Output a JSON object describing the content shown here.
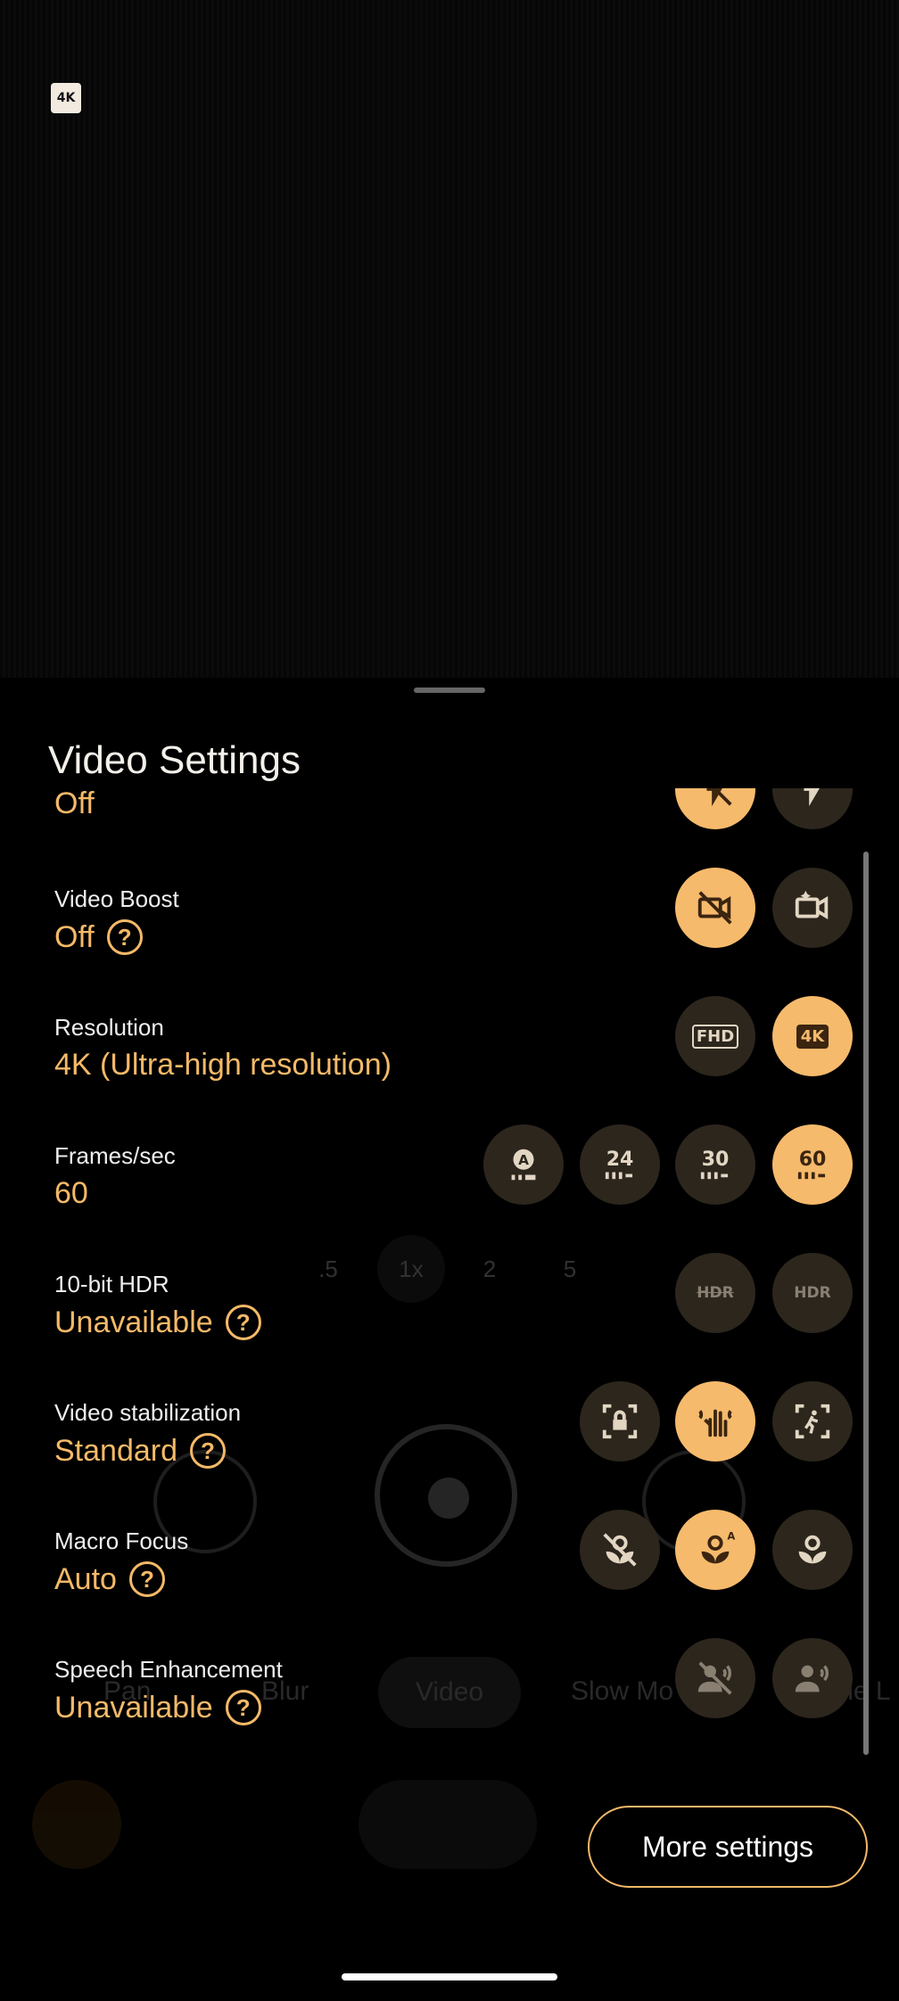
{
  "viewfinder": {
    "badge": "4K"
  },
  "background": {
    "zoom": [
      ".5",
      "1x",
      "2",
      "5"
    ],
    "modes": [
      "Pan",
      "Blur",
      "Video",
      "Slow Mo",
      "Time L"
    ]
  },
  "sheet": {
    "title": "Video Settings",
    "partial_value": "Off",
    "rows": [
      {
        "label": "Video Boost",
        "value": "Off",
        "help": "?"
      },
      {
        "label": "Resolution",
        "value": "4K (Ultra-high resolution)"
      },
      {
        "label": "Frames/sec",
        "value": "60"
      },
      {
        "label": "10-bit HDR",
        "value": "Unavailable",
        "help": "?"
      },
      {
        "label": "Video stabilization",
        "value": "Standard",
        "help": "?"
      },
      {
        "label": "Macro Focus",
        "value": "Auto",
        "help": "?"
      },
      {
        "label": "Speech Enhancement",
        "value": "Unavailable",
        "help": "?"
      }
    ],
    "option_text": {
      "fhd": "FHD",
      "uhd": "4K",
      "fps24": "24",
      "fps30": "30",
      "fps60": "60",
      "hdr_off": "HDR",
      "hdr_on": "HDR"
    },
    "more_settings": "More settings"
  },
  "colors": {
    "accent": "#f5b968",
    "selected_bg": "#f6ba6c",
    "option_bg": "#2c261d"
  }
}
